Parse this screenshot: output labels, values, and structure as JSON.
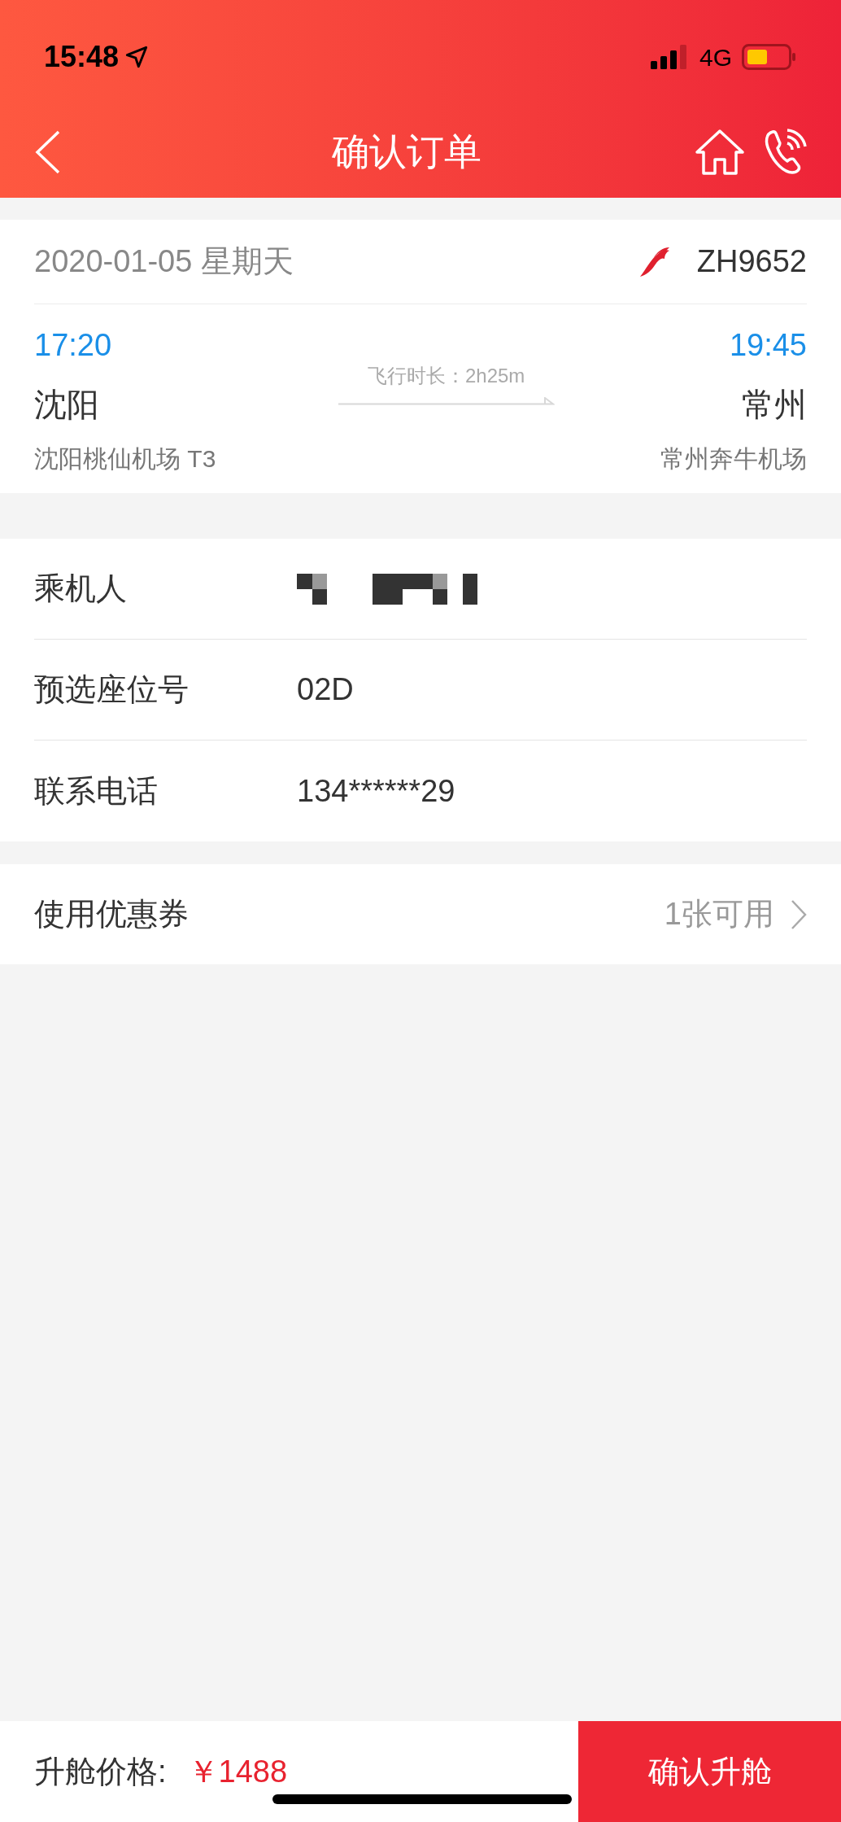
{
  "status_bar": {
    "time": "15:48",
    "network": "4G"
  },
  "header": {
    "title": "确认订单"
  },
  "flight": {
    "date": "2020-01-05 星期天",
    "flight_no": "ZH9652",
    "depart_time": "17:20",
    "arrive_time": "19:45",
    "depart_city": "沈阳",
    "arrive_city": "常州",
    "duration": "飞行时长：2h25m",
    "depart_airport": "沈阳桃仙机场 T3",
    "arrive_airport": "常州奔牛机场"
  },
  "details": [
    {
      "label": "乘机人",
      "kind": "masked"
    },
    {
      "label": "预选座位号",
      "kind": "text",
      "value": "02D"
    },
    {
      "label": "联系电话",
      "kind": "text",
      "value": "134******29"
    }
  ],
  "coupon": {
    "label": "使用优惠券",
    "value": "1张可用"
  },
  "footer": {
    "price_label": "升舱价格:",
    "price": "￥1488",
    "button": "确认升舱"
  }
}
